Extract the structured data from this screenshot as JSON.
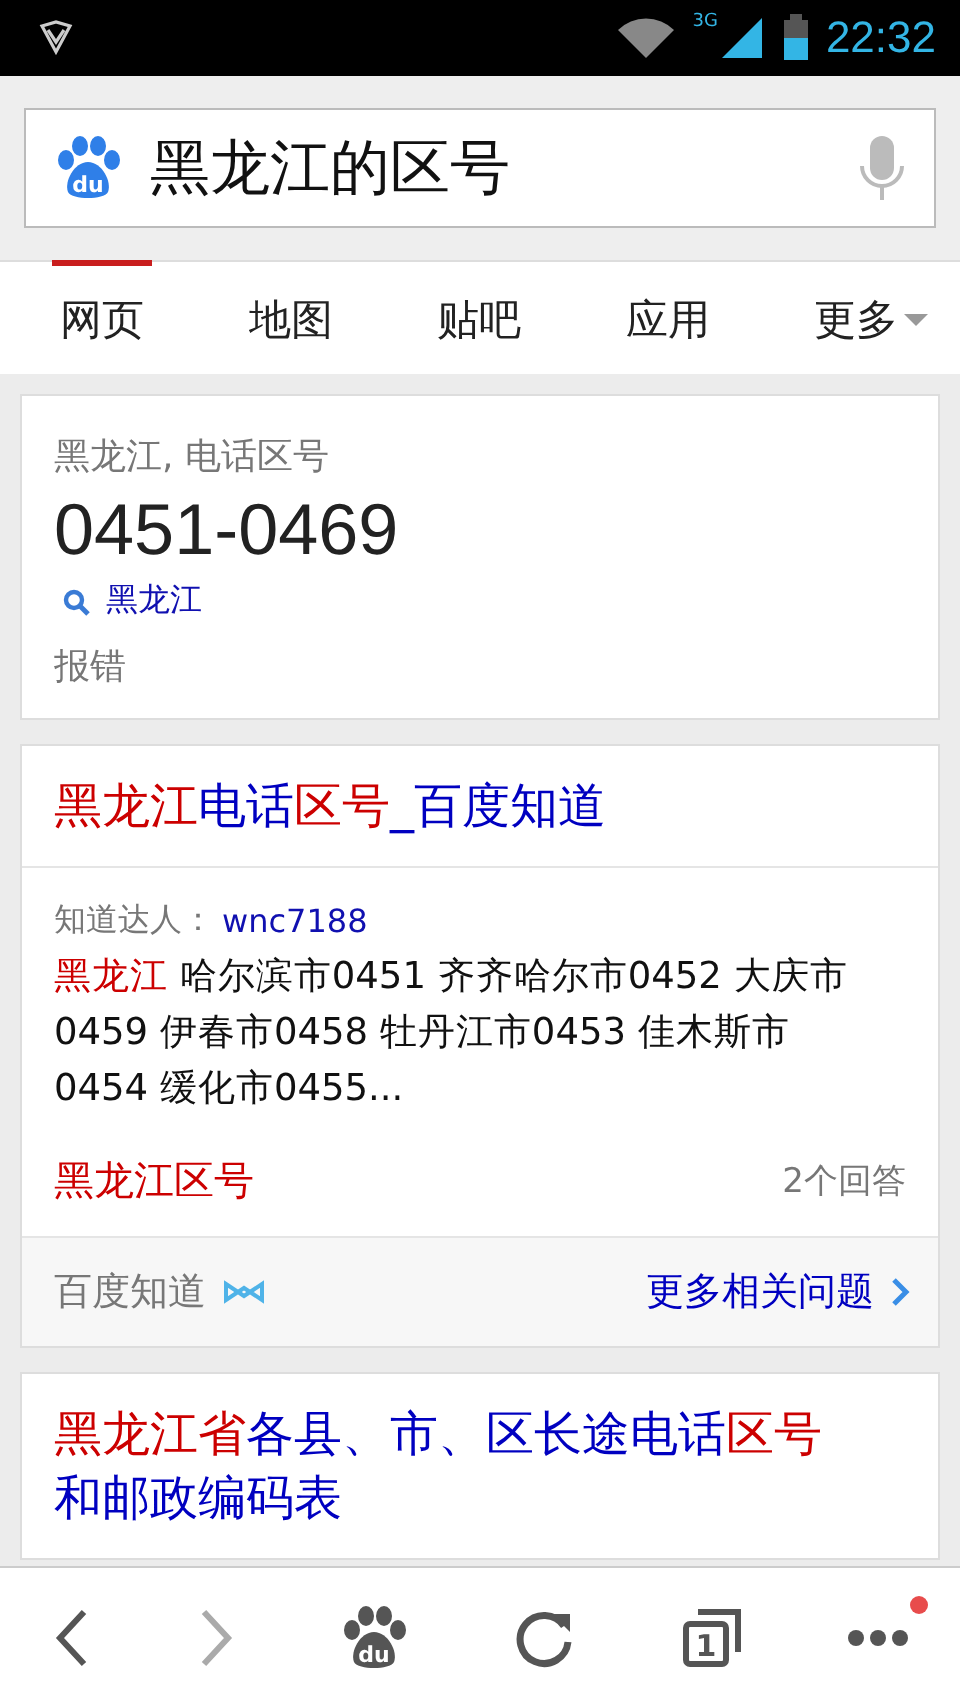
{
  "status_bar": {
    "time": "22:32",
    "network": "3G"
  },
  "search": {
    "logo_text": "du",
    "value": "黑龙江的区号"
  },
  "tabs": [
    {
      "label": "网页",
      "selected": true
    },
    {
      "label": "地图",
      "selected": false
    },
    {
      "label": "贴吧",
      "selected": false
    },
    {
      "label": "应用",
      "selected": false
    },
    {
      "label": "更多",
      "selected": false,
      "dropdown": true
    }
  ],
  "answer_card": {
    "subtitle": "黑龙江, 电话区号",
    "value": "0451-0469",
    "link": "黑龙江",
    "report": "报错"
  },
  "results": [
    {
      "kind": "zhidao",
      "title": [
        {
          "text": "黑龙江",
          "highlight": true
        },
        {
          "text": "电话",
          "highlight": false
        },
        {
          "text": "区号",
          "highlight": true
        },
        {
          "text": "_百度知道",
          "highlight": false
        }
      ],
      "expert_label": "知道达人：",
      "expert": "wnc7188",
      "snippet_highlight": "黑龙江",
      "snippet": "哈尔滨市0451 齐齐哈尔市0452 大庆市0459 伊春市0458 牡丹江市0453 佳木斯市0454 缓化市0455...",
      "question": "黑龙江区号",
      "answers": "2个回答",
      "source": "百度知道",
      "more": "更多相关问题"
    },
    {
      "kind": "web",
      "title": [
        {
          "text": "黑龙江省",
          "highlight": true
        },
        {
          "text": "各县、市、区长途电话",
          "highlight": false
        },
        {
          "text": "区号",
          "highlight": true
        },
        {
          "text": "和邮政编码表",
          "highlight": false
        }
      ]
    }
  ],
  "toolbar": {
    "logo_text": "du",
    "tab_count": "1",
    "notification": true
  }
}
